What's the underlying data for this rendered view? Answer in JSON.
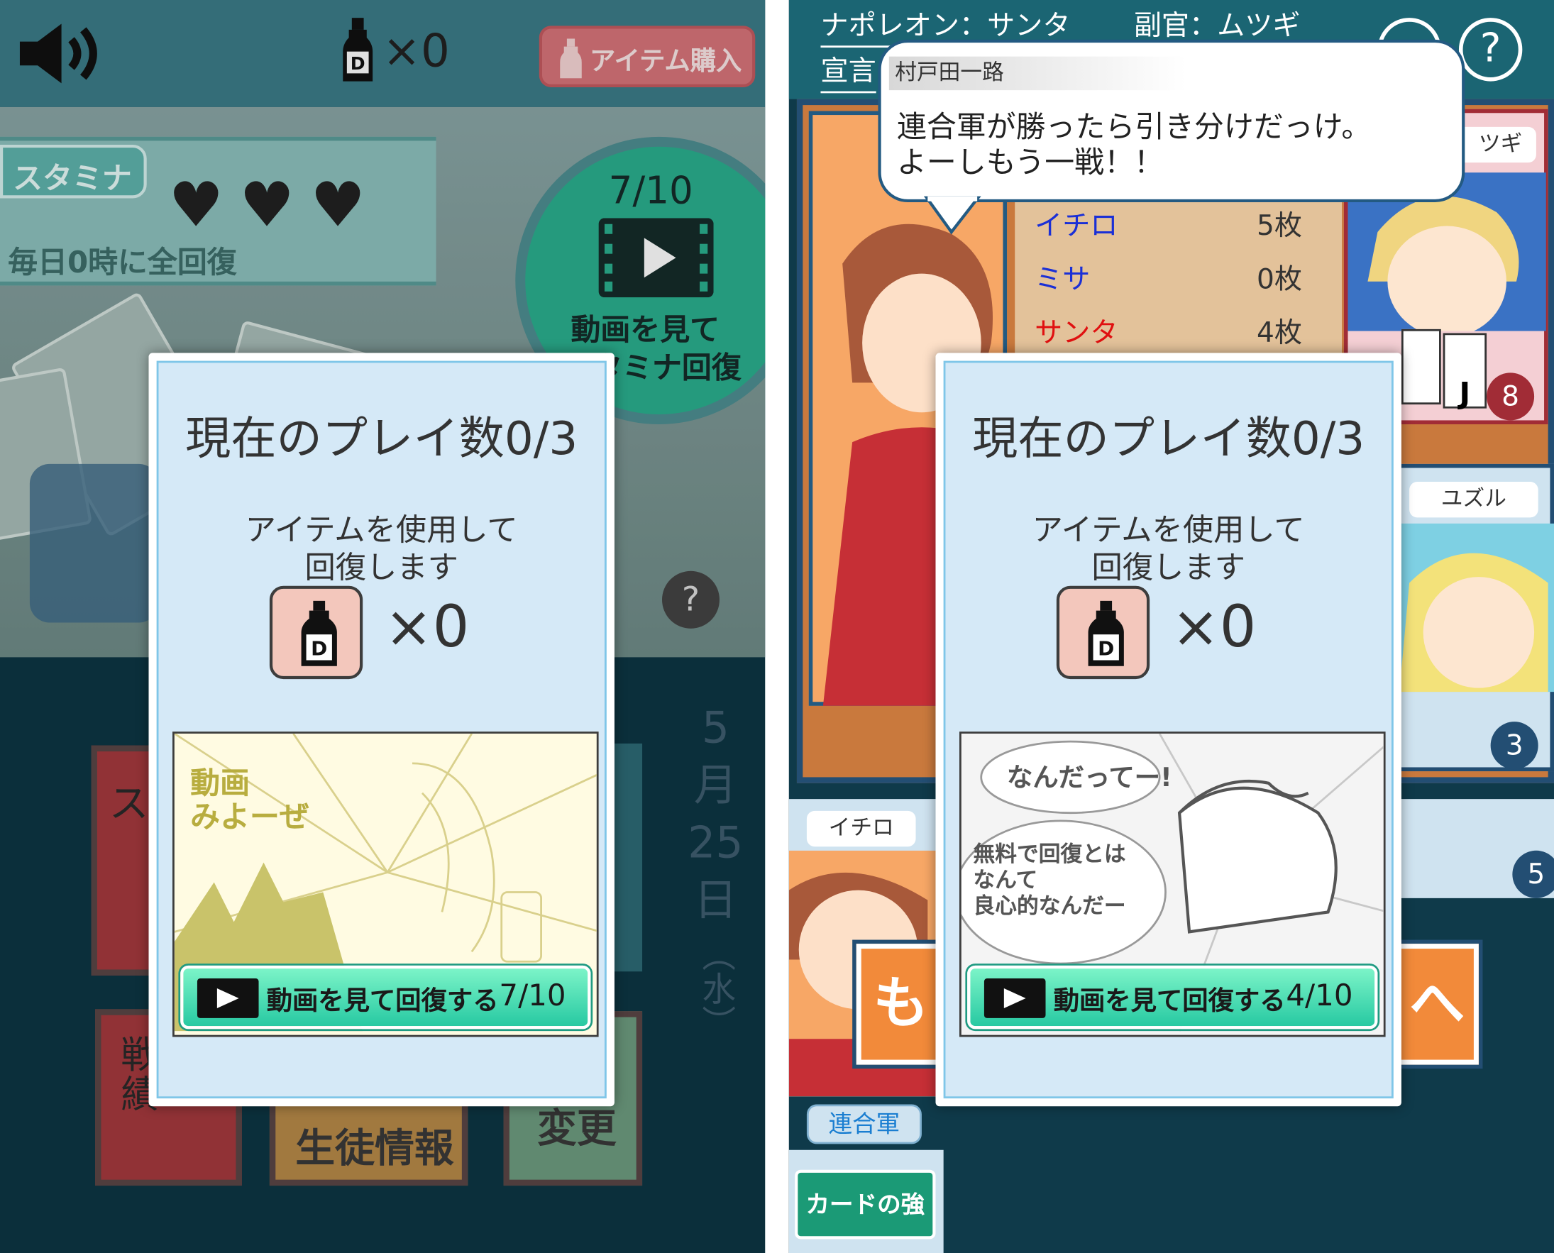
{
  "left": {
    "topbar": {
      "item_count": "×0",
      "buy_label": "アイテム購入"
    },
    "stamina": {
      "label": "スタミナ",
      "hearts": 3,
      "reset_note": "毎日0時に全回復"
    },
    "video_circle": {
      "count": "7/10",
      "label_line1": "動画を見て",
      "label_line2": "スタミナ回復"
    },
    "help": "?",
    "date": {
      "month": "5",
      "month_unit": "月",
      "day": "25",
      "day_unit": "日",
      "weekday": "（水）"
    },
    "menu_fragments": [
      "ス",
      "戦績",
      "生徒情報",
      "変更"
    ],
    "dialog": {
      "title": "現在のプレイ数0/3",
      "desc_line1": "アイテムを使用して",
      "desc_line2": "回復します",
      "item_letter": "D",
      "item_count": "×0",
      "promo_caption_line1": "動画",
      "promo_caption_line2": "みよーぜ",
      "watch_label": "動画を見て回復する",
      "watch_count": "7/10"
    }
  },
  "right": {
    "header": {
      "napoleon": "ナポレオン：サンタ",
      "adjutant": "副官：ムツギ",
      "declare": "宣言",
      "help": "?"
    },
    "speech": {
      "speaker": "村戸田一路",
      "line1": "連合軍が勝ったら引き分けだっけ。",
      "line2": "よーしもう一戦！！"
    },
    "scores": [
      {
        "name": "イチロ",
        "count": "5枚",
        "color": "#1a2fd6"
      },
      {
        "name": "ミサ",
        "count": "0枚",
        "color": "#1a2fd6"
      },
      {
        "name": "サンタ",
        "count": "4枚",
        "color": "#e01010"
      }
    ],
    "players": {
      "mutsugi": {
        "name": "ツギ",
        "cards": "8",
        "card_rank": "J"
      },
      "yuzuru": {
        "name": "ユズル",
        "cards": "3"
      },
      "ichiro": {
        "name": "イチロ",
        "cards": "5"
      }
    },
    "team_label": "連合軍",
    "card_strength_button": "カードの強さ",
    "side_buttons": {
      "left_char": "も",
      "right_char": "へ"
    },
    "dialog": {
      "title": "現在のプレイ数0/3",
      "desc_line1": "アイテムを使用して",
      "desc_line2": "回復します",
      "item_letter": "D",
      "item_count": "×0",
      "promo_bubble1": "なんだってー!",
      "promo_bubble2_line1": "無料で回復とは",
      "promo_bubble2_line2": "なんて",
      "promo_bubble2_line3": "良心的なんだー",
      "watch_label": "動画を見て回復する",
      "watch_count": "4/10"
    }
  },
  "colors": {
    "accent_green": "#2bc9a0",
    "dialog_bg": "#d5e9f7",
    "dialog_border": "#7fc6e8",
    "dark_bg": "#0f3a4a",
    "orange": "#f28a3a"
  }
}
